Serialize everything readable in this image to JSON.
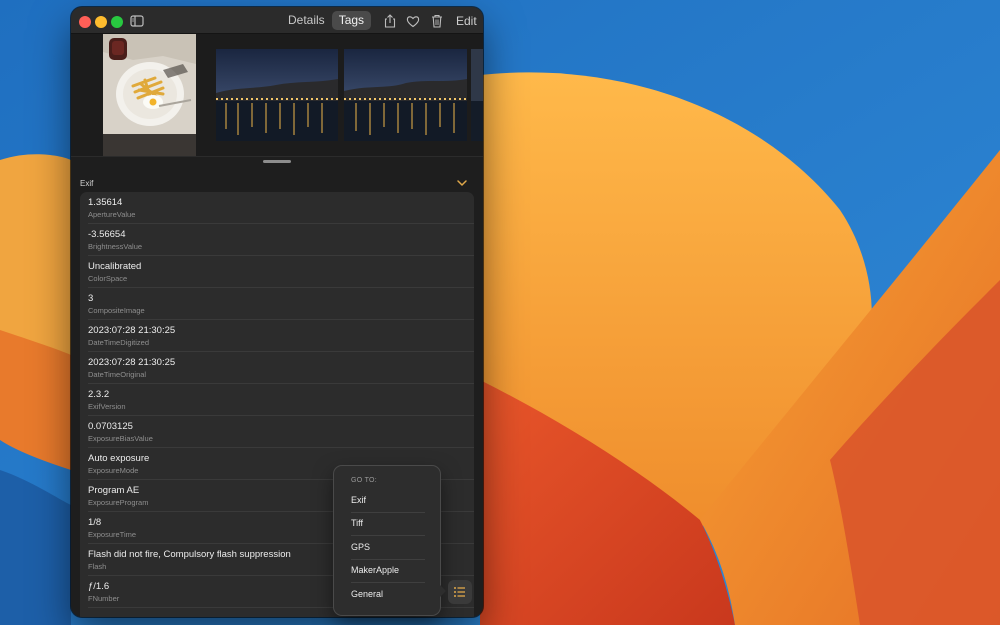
{
  "titlebar": {
    "tabs": [
      {
        "label": "Details",
        "active": false
      },
      {
        "label": "Tags",
        "active": true
      }
    ],
    "edit_label": "Edit",
    "icons": [
      "sidebar-toggle-icon",
      "share-icon",
      "heart-icon",
      "trash-icon"
    ]
  },
  "section": {
    "title": "Exif",
    "rows": [
      {
        "value": "1.35614",
        "key": "ApertureValue"
      },
      {
        "value": "-3.56654",
        "key": "BrightnessValue"
      },
      {
        "value": "Uncalibrated",
        "key": "ColorSpace"
      },
      {
        "value": "3",
        "key": "CompositeImage"
      },
      {
        "value": "2023:07:28 21:30:25",
        "key": "DateTimeDigitized"
      },
      {
        "value": "2023:07:28 21:30:25",
        "key": "DateTimeOriginal"
      },
      {
        "value": "2.3.2",
        "key": "ExifVersion"
      },
      {
        "value": "0.0703125",
        "key": "ExposureBiasValue"
      },
      {
        "value": "Auto exposure",
        "key": "ExposureMode"
      },
      {
        "value": "Program AE",
        "key": "ExposureProgram"
      },
      {
        "value": "1/8",
        "key": "ExposureTime"
      },
      {
        "value": "Flash did not fire, Compulsory flash suppression",
        "key": "Flash"
      },
      {
        "value": "ƒ/1.6",
        "key": "FNumber"
      }
    ]
  },
  "popover": {
    "title": "GO TO:",
    "items": [
      "Exif",
      "Tiff",
      "GPS",
      "MakerApple",
      "General"
    ]
  },
  "colors": {
    "window_bg": "#1e1e1e",
    "list_bg": "#2c2c2c",
    "accent_chevron": "#e0a84a",
    "close": "#ff5f57",
    "minimize": "#febc2e",
    "zoom": "#28c840"
  }
}
